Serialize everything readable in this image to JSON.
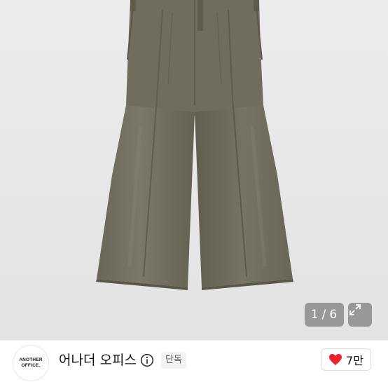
{
  "image": {
    "subject_icon": "pants-photo",
    "counter": {
      "current": "1",
      "separator": "/",
      "total": "6"
    },
    "expand_icon": "expand-icon"
  },
  "shop": {
    "logo_text": [
      "ANOTHER",
      "OFFICE."
    ],
    "name": "어나더 오피스",
    "info_icon": "info-icon",
    "badge": "단독",
    "likes": {
      "icon": "heart-icon",
      "count": "7만",
      "color": "#e8222e"
    }
  }
}
